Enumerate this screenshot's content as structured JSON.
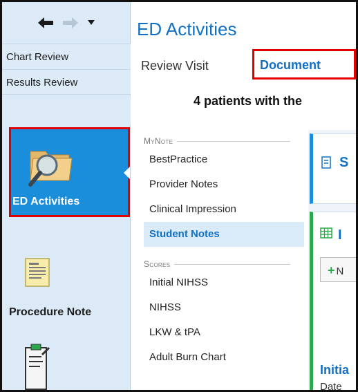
{
  "leftnav": {
    "chart_review": "Chart Review",
    "results_review": "Results Review",
    "ed_activities": "ED Activities",
    "procedure_note": "Procedure Note"
  },
  "main": {
    "title": "ED Activities",
    "tabs": {
      "review_visit": "Review Visit",
      "document": "Document"
    },
    "patients_text": "4 patients with the",
    "sections": [
      {
        "header": "MyNote",
        "items": [
          "BestPractice",
          "Provider Notes",
          "Clinical Impression",
          "Student Notes"
        ]
      },
      {
        "header": "Scores",
        "items": [
          "Initial NIHSS",
          "NIHSS",
          "LKW & tPA",
          "Adult Burn Chart"
        ]
      }
    ],
    "active_item": "Student Notes",
    "card1_text": "S",
    "card2_text": "I",
    "new_button": "N",
    "initial_text": "Initia",
    "date_text": "Date"
  },
  "colors": {
    "accent": "#1270c4",
    "ed_button_bg": "#1a8ddb",
    "highlight_border": "#e00000",
    "nav_bg": "#dbeaf6",
    "green": "#2ca84c"
  },
  "icons": [
    "back-arrow-icon",
    "forward-arrow-icon",
    "dropdown-icon",
    "folder-search-icon",
    "document-icon",
    "clipboard-icon",
    "note-icon",
    "grid-icon",
    "plus-icon"
  ]
}
